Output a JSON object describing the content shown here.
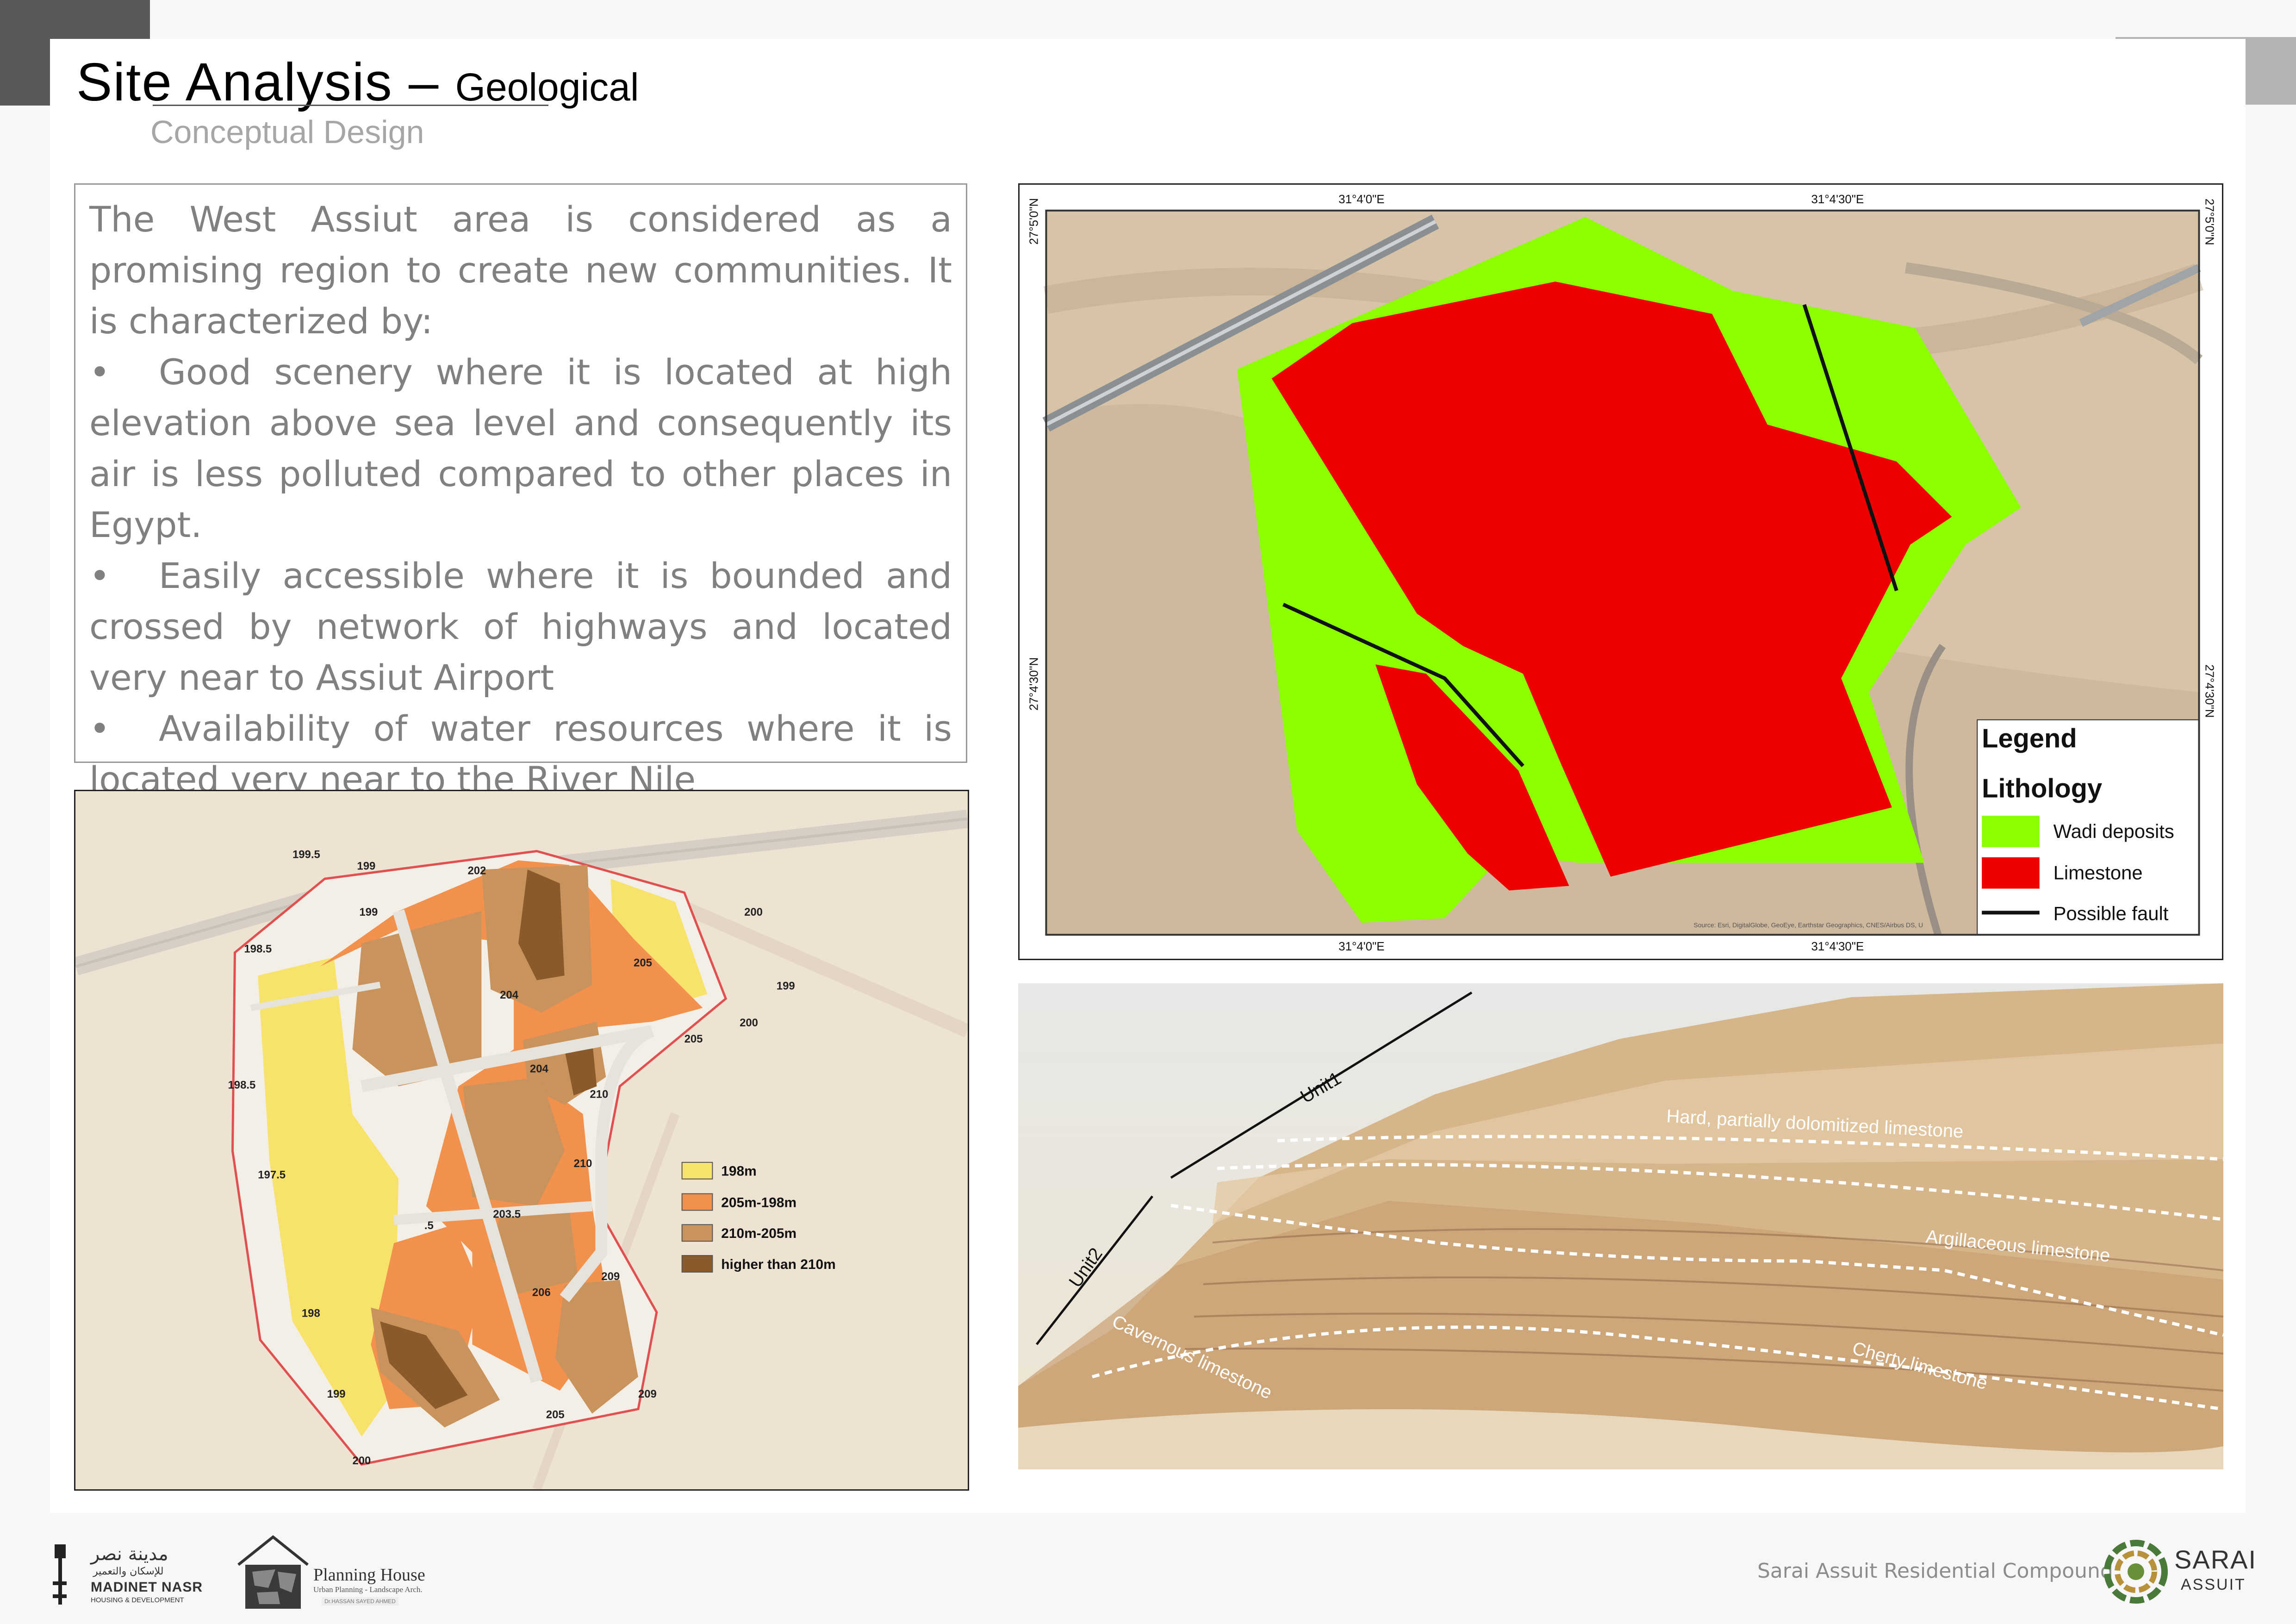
{
  "header": {
    "title_main": "Site Analysis – ",
    "title_sub": "Geological",
    "subtitle": "Conceptual Design"
  },
  "description": {
    "intro": "The West Assiut area is considered as a promising region to create new communities. It is characterized by:",
    "bullets": [
      "Good scenery where it is located at high elevation above sea level and consequently its air is less polluted compared to other places in Egypt.",
      "Easily accessible where it is bounded and crossed by network of highways and located very near to Assiut Airport",
      "Availability of water resources where it is located very near to the River Nile"
    ],
    "bullet_symbol": "•"
  },
  "elevation_map": {
    "legend": [
      {
        "label": "198m",
        "color": "#f7e36b"
      },
      {
        "label": "205m-198m",
        "color": "#f2914e"
      },
      {
        "label": "210m-205m",
        "color": "#c9935e"
      },
      {
        "label": "higher than 210m",
        "color": "#8a5a2b"
      }
    ],
    "spot_heights": [
      "199.5",
      "199",
      "202",
      "200",
      "199",
      "198.5",
      "205",
      "204",
      "199",
      "200",
      "205",
      "204",
      "210",
      "198.5",
      "197.5",
      "210",
      "203.5",
      "209",
      "206",
      "198",
      "199",
      "209",
      "205",
      "200",
      ".5"
    ]
  },
  "geology_map": {
    "coords_top": [
      "31°4'0\"E",
      "31°4'30\"E"
    ],
    "coords_bottom": [
      "31°4'0\"E",
      "31°4'30\"E"
    ],
    "coords_left": [
      "27°5'0\"N",
      "27°4'30\"N"
    ],
    "coords_right": [
      "27°5'0\"N",
      "27°4'30\"N"
    ],
    "legend_title": "Legend",
    "legend_subtitle": "Lithology",
    "legend_items": [
      {
        "label": "Wadi deposits",
        "color": "#8cff00"
      },
      {
        "label": "Limestone",
        "color": "#ee0000"
      },
      {
        "label": "Possible fault",
        "color": "#111111"
      }
    ],
    "source_note": "Source: Esri, DigitalGlobe, GeoEye, Earthstar Geographics, CNES/Airbus DS, U"
  },
  "rock_photo": {
    "labels": {
      "unit1": "Unit1",
      "unit2": "Unit2",
      "hard": "Hard, partially dolomitized limestone",
      "argillaceous": "Argillaceous limestone",
      "cherty": "Cherty limestone",
      "cavernous": "Cavernous limestone"
    }
  },
  "footer": {
    "project": "Sarai Assuit Residential Compound",
    "logo1_ar": "مدينة نصر",
    "logo1_ar_sub": "للإسكان والتعمير",
    "logo1_en": "MADINET NASR",
    "logo1_sub": "HOUSING & DEVELOPMENT",
    "logo2_name": "Planning House",
    "logo2_sub": "Urban Planning - Landscape Arch.",
    "logo2_person": "Dr.HASSAN SAYED AHMED",
    "logo3_name": "SARAI",
    "logo3_sub": "ASSUIT"
  }
}
